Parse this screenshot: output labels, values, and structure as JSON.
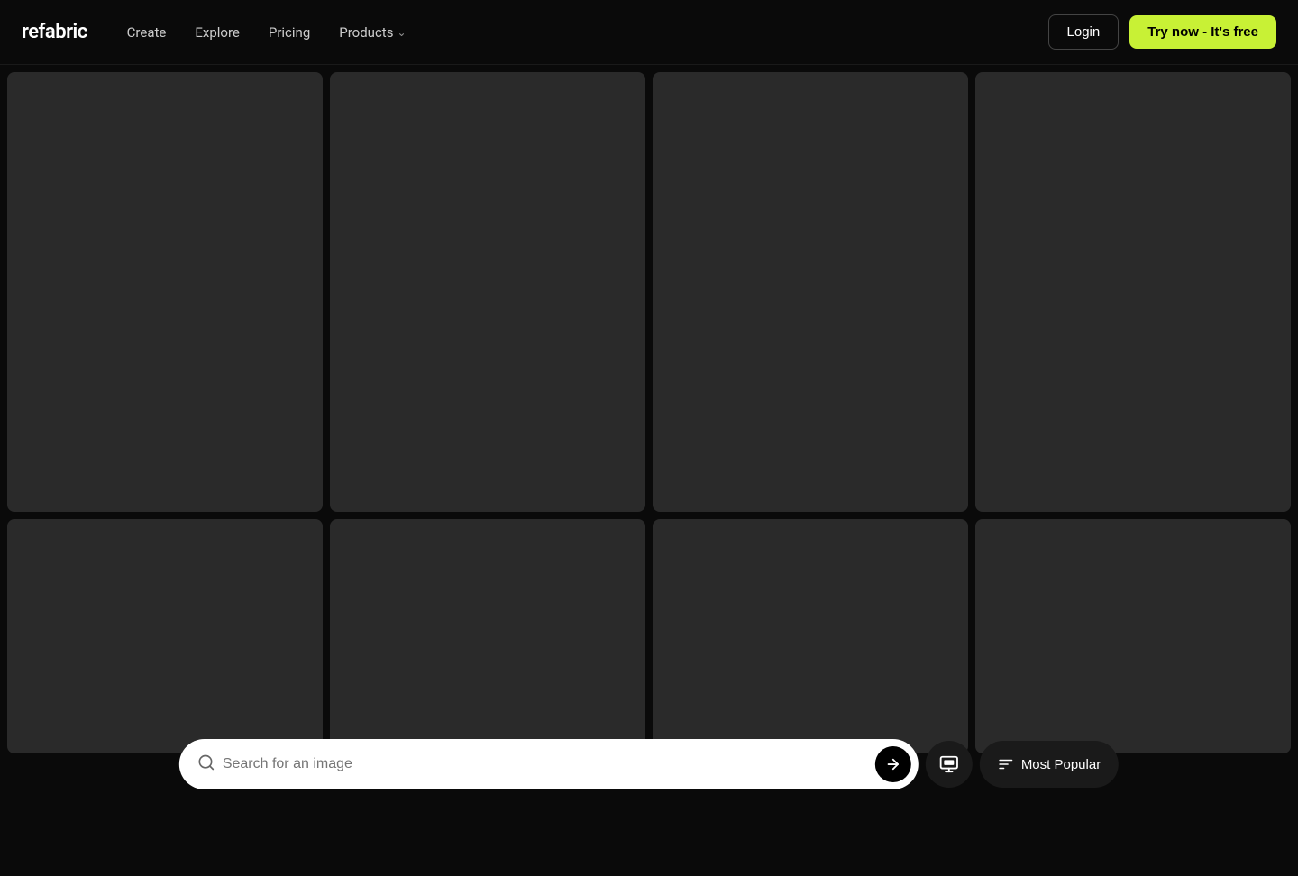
{
  "navbar": {
    "logo": "refabric",
    "links": [
      {
        "id": "create",
        "label": "Create",
        "hasChevron": false
      },
      {
        "id": "explore",
        "label": "Explore",
        "hasChevron": false
      },
      {
        "id": "pricing",
        "label": "Pricing",
        "hasChevron": false
      },
      {
        "id": "products",
        "label": "Products",
        "hasChevron": true
      }
    ],
    "login_label": "Login",
    "try_label": "Try now - It's free"
  },
  "gallery": {
    "cards_row1": [
      {
        "id": 1
      },
      {
        "id": 2
      },
      {
        "id": 3
      },
      {
        "id": 4
      }
    ],
    "cards_row2": [
      {
        "id": 5
      },
      {
        "id": 6
      },
      {
        "id": 7
      },
      {
        "id": 8
      }
    ]
  },
  "search": {
    "placeholder": "Search for an image",
    "submit_arrow": "→",
    "filter_icon": "layers",
    "sort_label": "Most Popular"
  }
}
